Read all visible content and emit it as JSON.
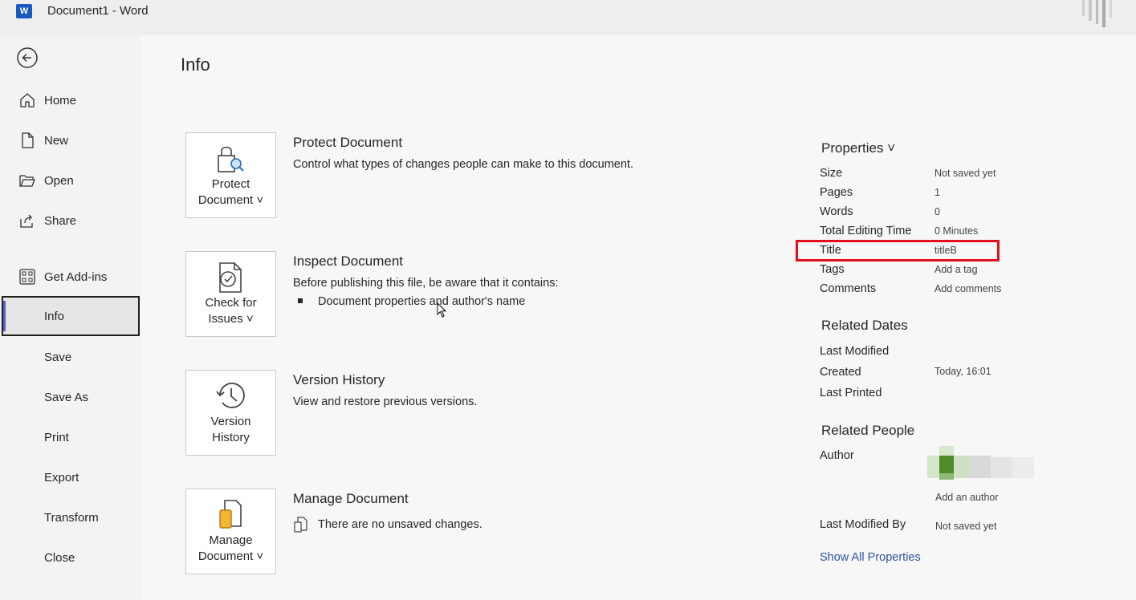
{
  "titlebar": {
    "app_logo_letter": "W",
    "title": "Document1  -  Word"
  },
  "sidebar": {
    "items": [
      {
        "label": "Home",
        "icon": "home-icon"
      },
      {
        "label": "New",
        "icon": "new-document-icon"
      },
      {
        "label": "Open",
        "icon": "folder-open-icon"
      },
      {
        "label": "Share",
        "icon": "share-icon"
      },
      {
        "label": "Get Add-ins",
        "icon": "add-ins-icon"
      },
      {
        "label": "Info"
      },
      {
        "label": "Save"
      },
      {
        "label": "Save As"
      },
      {
        "label": "Print"
      },
      {
        "label": "Export"
      },
      {
        "label": "Transform"
      },
      {
        "label": "Close"
      }
    ],
    "active": "Info"
  },
  "main": {
    "page_title": "Info",
    "sections": [
      {
        "button_label": "Protect Document ˅",
        "title": "Protect Document",
        "description": "Control what types of changes people can make to this document."
      },
      {
        "button_label": "Check for Issues ˅",
        "title": "Inspect Document",
        "description": "Before publishing this file, be aware that it contains:",
        "bullet": "Document properties and author's name"
      },
      {
        "button_label": "Version History",
        "title": "Version History",
        "description": "View and restore previous versions."
      },
      {
        "button_label": "Manage Document ˅",
        "title": "Manage Document",
        "description": "There are no unsaved changes."
      }
    ]
  },
  "properties": {
    "header": "Properties ˅",
    "rows": [
      {
        "label": "Size",
        "value": "Not saved yet"
      },
      {
        "label": "Pages",
        "value": "1"
      },
      {
        "label": "Words",
        "value": "0"
      },
      {
        "label": "Total Editing Time",
        "value": "0 Minutes"
      },
      {
        "label": "Title",
        "value": "titleB"
      },
      {
        "label": "Tags",
        "value": "Add a tag"
      },
      {
        "label": "Comments",
        "value": "Add comments"
      }
    ],
    "related_dates": {
      "header": "Related Dates",
      "rows": [
        {
          "label": "Last Modified",
          "value": ""
        },
        {
          "label": "Created",
          "value": "Today, 16:01"
        },
        {
          "label": "Last Printed",
          "value": ""
        }
      ]
    },
    "related_people": {
      "header": "Related People",
      "author_label": "Author",
      "add_author": "Add an author",
      "last_modified_by_label": "Last Modified By",
      "last_modified_by_value": "Not saved yet"
    },
    "show_all": "Show All Properties"
  },
  "colors": {
    "accent": "#5b5fc7",
    "highlight": "#e01020",
    "link": "#2f5597",
    "word_blue": "#185abd"
  }
}
